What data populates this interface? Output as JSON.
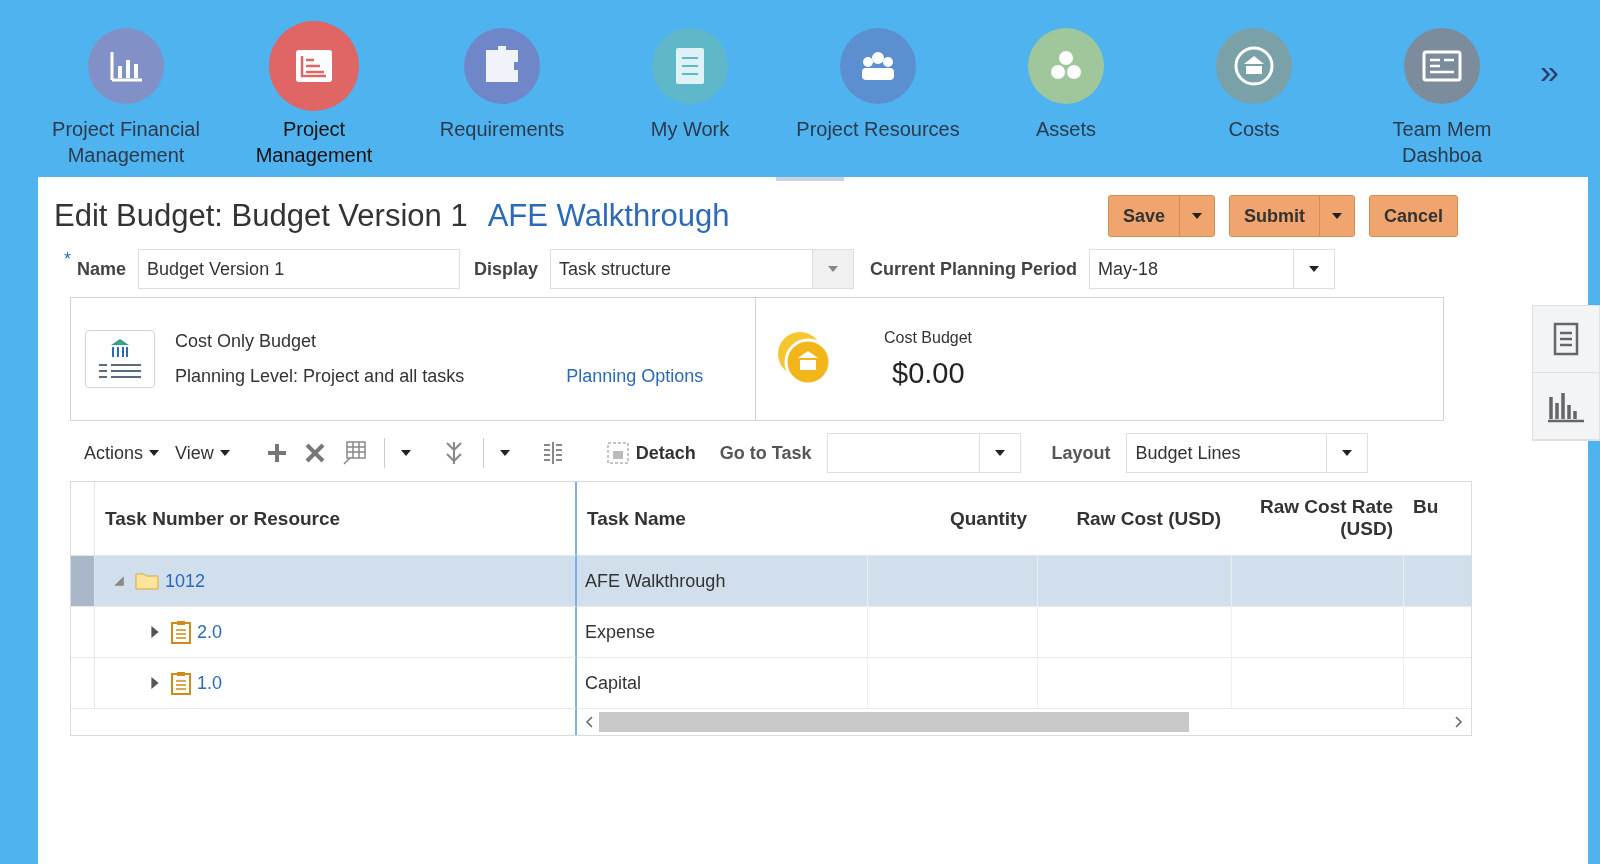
{
  "nav": {
    "items": [
      {
        "label": "Project Financial Management",
        "color": "#8191c8",
        "selected": false
      },
      {
        "label": "Project Management",
        "color": "#e06666",
        "selected": true
      },
      {
        "label": "Requirements",
        "color": "#6f86c9",
        "selected": false
      },
      {
        "label": "My Work",
        "color": "#5fb8c9",
        "selected": false
      },
      {
        "label": "Project Resources",
        "color": "#5b8fd0",
        "selected": false
      },
      {
        "label": "Assets",
        "color": "#9fc79b",
        "selected": false
      },
      {
        "label": "Costs",
        "color": "#7aa0a8",
        "selected": false
      },
      {
        "label": "Team Mem Dashboa",
        "color": "#7c8c9c",
        "selected": false
      }
    ],
    "more": "»"
  },
  "page": {
    "title": "Edit Budget: Budget Version 1",
    "subtitle": "AFE Walkthrough",
    "buttons": [
      {
        "label": "Save",
        "menu": true
      },
      {
        "label": "Submit",
        "menu": true
      },
      {
        "label": "Cancel",
        "menu": false
      }
    ]
  },
  "form": {
    "required_mark": "*",
    "name_label": "Name",
    "name_value": "Budget Version 1",
    "display_label": "Display",
    "display_value": "Task structure",
    "period_label": "Current Planning Period",
    "period_value": "May-18"
  },
  "summary": {
    "budget_type": "Cost Only Budget",
    "planning_level": "Planning Level: Project and all tasks",
    "link": "Planning Options",
    "cost_label": "Cost Budget",
    "cost_value": "$0.00"
  },
  "toolbar": {
    "actions": "Actions",
    "view": "View",
    "detach": "Detach",
    "goto_label": "Go to Task",
    "layout_label": "Layout",
    "layout_value": "Budget Lines"
  },
  "table": {
    "columns": [
      "Task Number or Resource",
      "Task Name",
      "Quantity",
      "Raw Cost (USD)",
      "Raw Cost Rate (USD)",
      "Bu"
    ],
    "rows": [
      {
        "number": "1012",
        "name": "AFE Walkthrough",
        "kind": "folder",
        "expanded": true,
        "selected": true,
        "children": [
          {
            "number": "2.0",
            "name": "Expense",
            "kind": "task",
            "expanded": false,
            "selected": false
          },
          {
            "number": "1.0",
            "name": "Capital",
            "kind": "task",
            "expanded": false,
            "selected": false
          }
        ]
      }
    ]
  }
}
